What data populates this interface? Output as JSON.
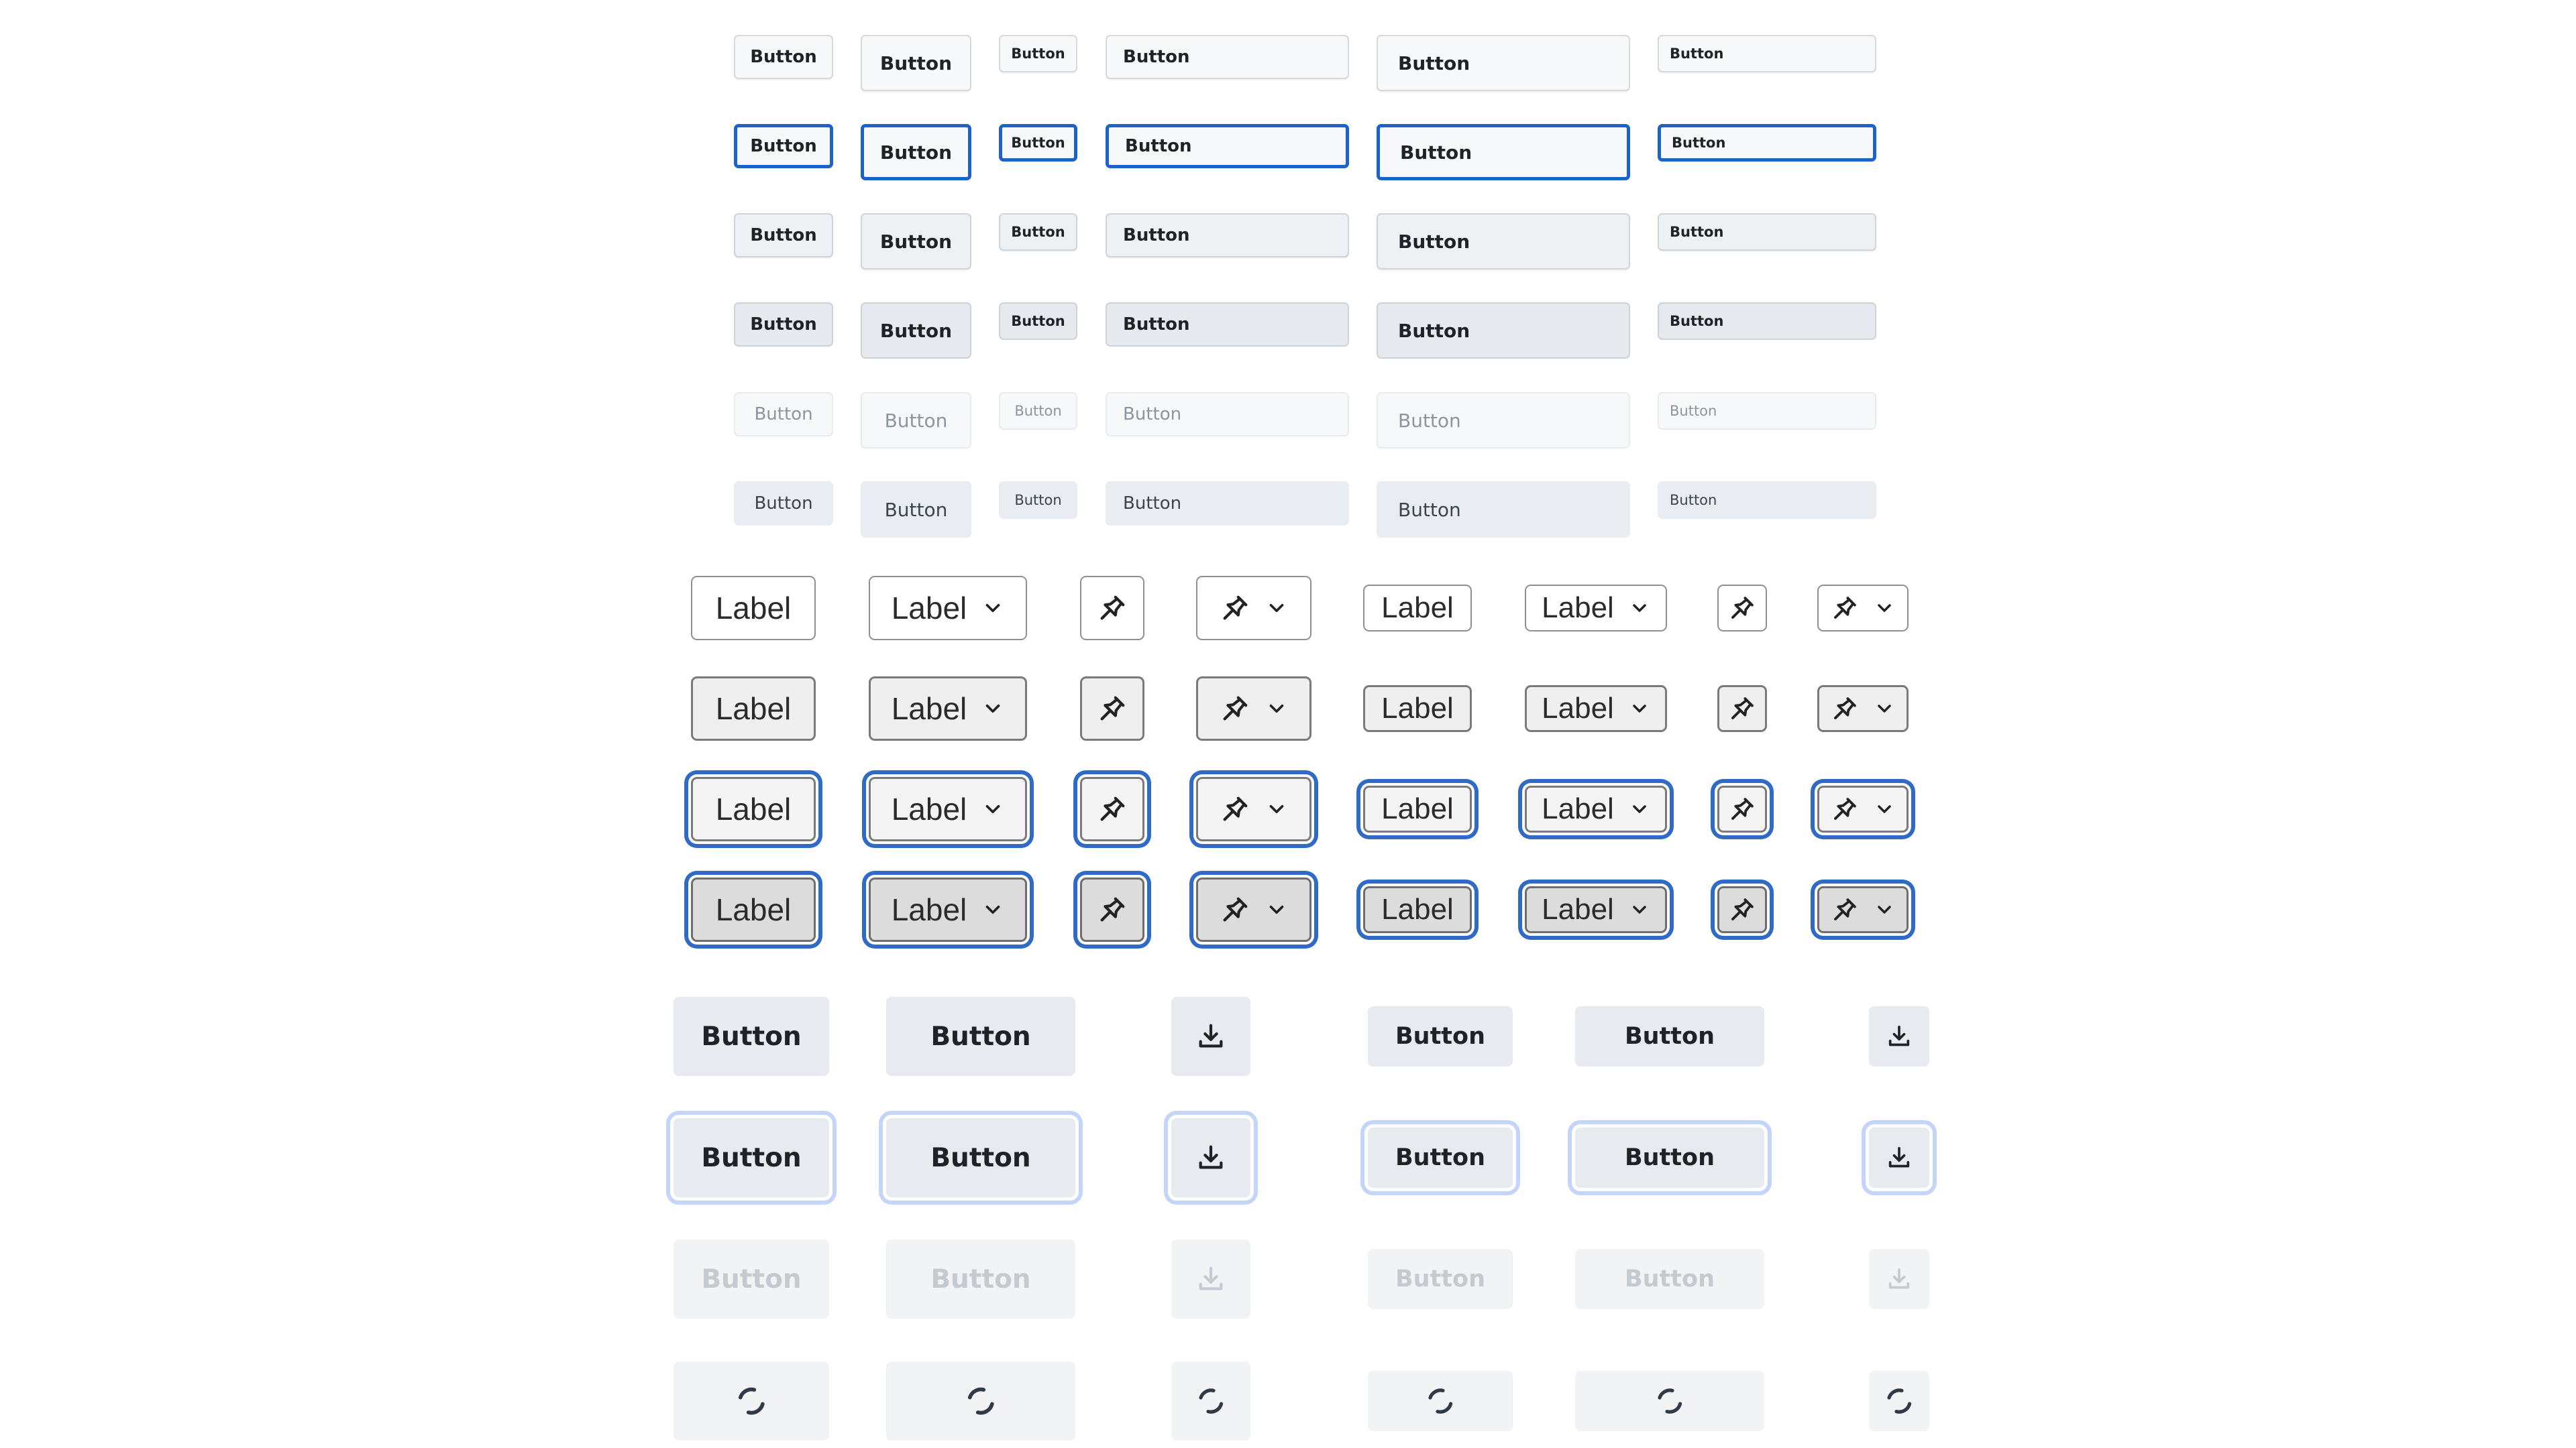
{
  "sectionA": {
    "label": "Button",
    "rows": [
      {
        "state": "default"
      },
      {
        "state": "focus"
      },
      {
        "state": "hover"
      },
      {
        "state": "active"
      },
      {
        "state": "disabled"
      },
      {
        "state": "invisible"
      }
    ]
  },
  "sectionB": {
    "label": "Label",
    "icons": {
      "pin": "pin-icon",
      "chevron": "chevron-down-icon"
    },
    "rows": [
      {
        "state": "rest"
      },
      {
        "state": "hover"
      },
      {
        "state": "focus"
      },
      {
        "state": "pressed"
      }
    ]
  },
  "sectionC": {
    "label": "Button",
    "icons": {
      "download": "download-icon",
      "spinner": "spinner-icon"
    },
    "rows": [
      {
        "state": "rest"
      },
      {
        "state": "focus"
      },
      {
        "state": "disabled"
      },
      {
        "state": "loading"
      }
    ]
  },
  "colors": {
    "focus_blue": "#1c62c9",
    "focus_ring_light": "#c3d5f9",
    "button_bg": "#f6f8fa",
    "grey_button_bg": "#e7eaee",
    "text": "#1f2328",
    "disabled_text": "#8c959f"
  }
}
